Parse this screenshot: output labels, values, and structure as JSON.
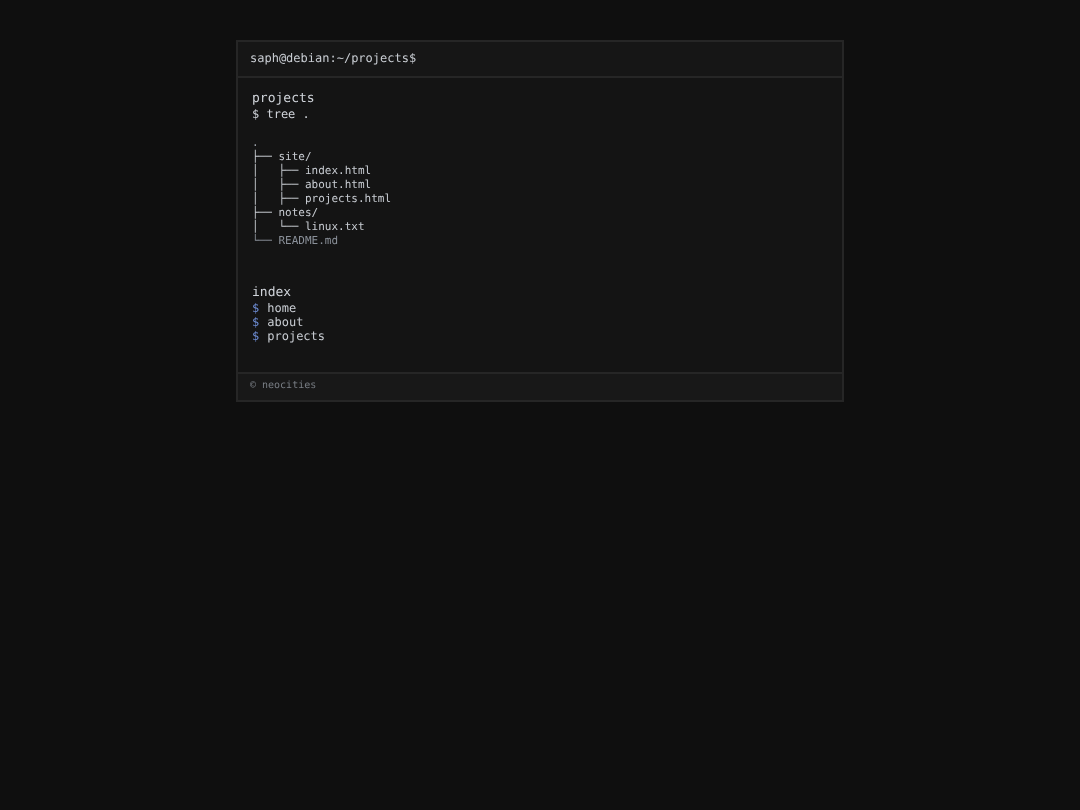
{
  "window": {
    "title": "saph@debian:~/projects$"
  },
  "main": {
    "heading": "projects",
    "command": "$ tree .",
    "tree": [
      {
        "text": ".",
        "kind": "entry"
      },
      {
        "text": "├── site/",
        "kind": "dir"
      },
      {
        "text": "│   ├── index.html",
        "kind": "file"
      },
      {
        "text": "│   ├── about.html",
        "kind": "file"
      },
      {
        "text": "│   ├── projects.html",
        "kind": "file"
      },
      {
        "text": "├── notes/",
        "kind": "dir"
      },
      {
        "text": "│   └── linux.txt",
        "kind": "file"
      },
      {
        "text": "└── README.md",
        "kind": "dim"
      }
    ]
  },
  "nav": {
    "heading": "index",
    "links": [
      {
        "prompt": "$",
        "label": "home"
      },
      {
        "prompt": "$",
        "label": "about"
      },
      {
        "prompt": "$",
        "label": "projects"
      }
    ]
  },
  "footer": {
    "text": "© neocities"
  }
}
